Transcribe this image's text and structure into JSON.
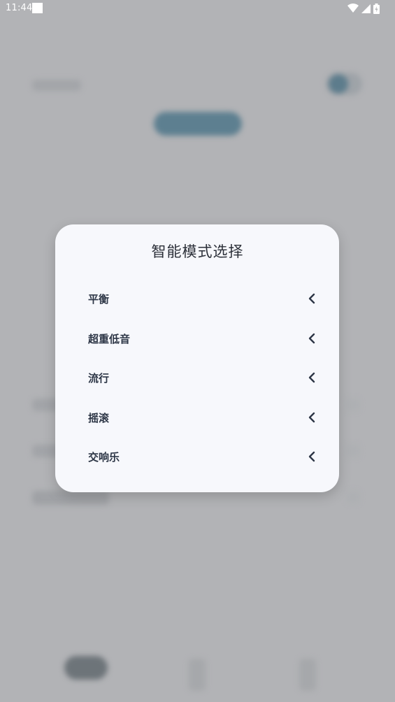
{
  "status_bar": {
    "time": "11:44",
    "icons": [
      "notification-square-icon",
      "wifi-icon",
      "cell-signal-icon",
      "battery-icon"
    ]
  },
  "dialog": {
    "title": "智能模式选择",
    "items": [
      {
        "label": "平衡",
        "icon": "chevron-left-icon"
      },
      {
        "label": "超重低音",
        "icon": "chevron-left-icon"
      },
      {
        "label": "流行",
        "icon": "chevron-left-icon"
      },
      {
        "label": "摇滚",
        "icon": "chevron-left-icon"
      },
      {
        "label": "交响乐",
        "icon": "chevron-left-icon"
      }
    ]
  },
  "colors": {
    "overlay_bg": "#b2b3b6",
    "dialog_bg": "#f7f8fc",
    "title_text": "#2b2f38",
    "item_text": "#2d3646",
    "accent": "#5a7f92"
  }
}
